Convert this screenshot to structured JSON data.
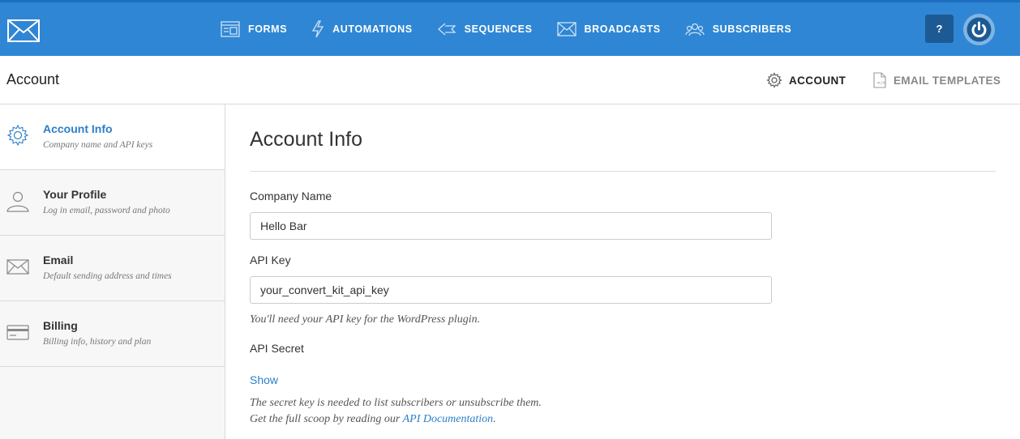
{
  "nav": {
    "items": [
      {
        "label": "FORMS",
        "icon": "forms-icon"
      },
      {
        "label": "AUTOMATIONS",
        "icon": "lightning-icon"
      },
      {
        "label": "SEQUENCES",
        "icon": "sequences-icon"
      },
      {
        "label": "BROADCASTS",
        "icon": "envelope-icon"
      },
      {
        "label": "SUBSCRIBERS",
        "icon": "users-icon"
      }
    ],
    "help_label": "?",
    "brand_color": "#2f86d4"
  },
  "subheader": {
    "title": "Account",
    "tabs": [
      {
        "label": "ACCOUNT",
        "icon": "gear-icon"
      },
      {
        "label": "EMAIL TEMPLATES",
        "icon": "document-icon"
      }
    ]
  },
  "sidebar": {
    "items": [
      {
        "title": "Account Info",
        "desc": "Company name and API keys",
        "icon": "gear-icon"
      },
      {
        "title": "Your Profile",
        "desc": "Log in email, password and photo",
        "icon": "user-icon"
      },
      {
        "title": "Email",
        "desc": "Default sending address and times",
        "icon": "envelope-icon"
      },
      {
        "title": "Billing",
        "desc": "Billing info, history and plan",
        "icon": "credit-card-icon"
      }
    ]
  },
  "main": {
    "title": "Account Info",
    "company_label": "Company Name",
    "company_value": "Hello Bar",
    "api_key_label": "API Key",
    "api_key_value": "your_convert_kit_api_key",
    "api_key_hint": "You'll need your API key for the WordPress plugin.",
    "api_secret_label": "API Secret",
    "show_label": "Show",
    "secret_hint_1": "The secret key is needed to list subscribers or unsubscribe them.",
    "secret_hint_2_prefix": "Get the full scoop by reading our",
    "secret_hint_2_link": "API Documentation",
    "secret_hint_2_suffix": "."
  }
}
